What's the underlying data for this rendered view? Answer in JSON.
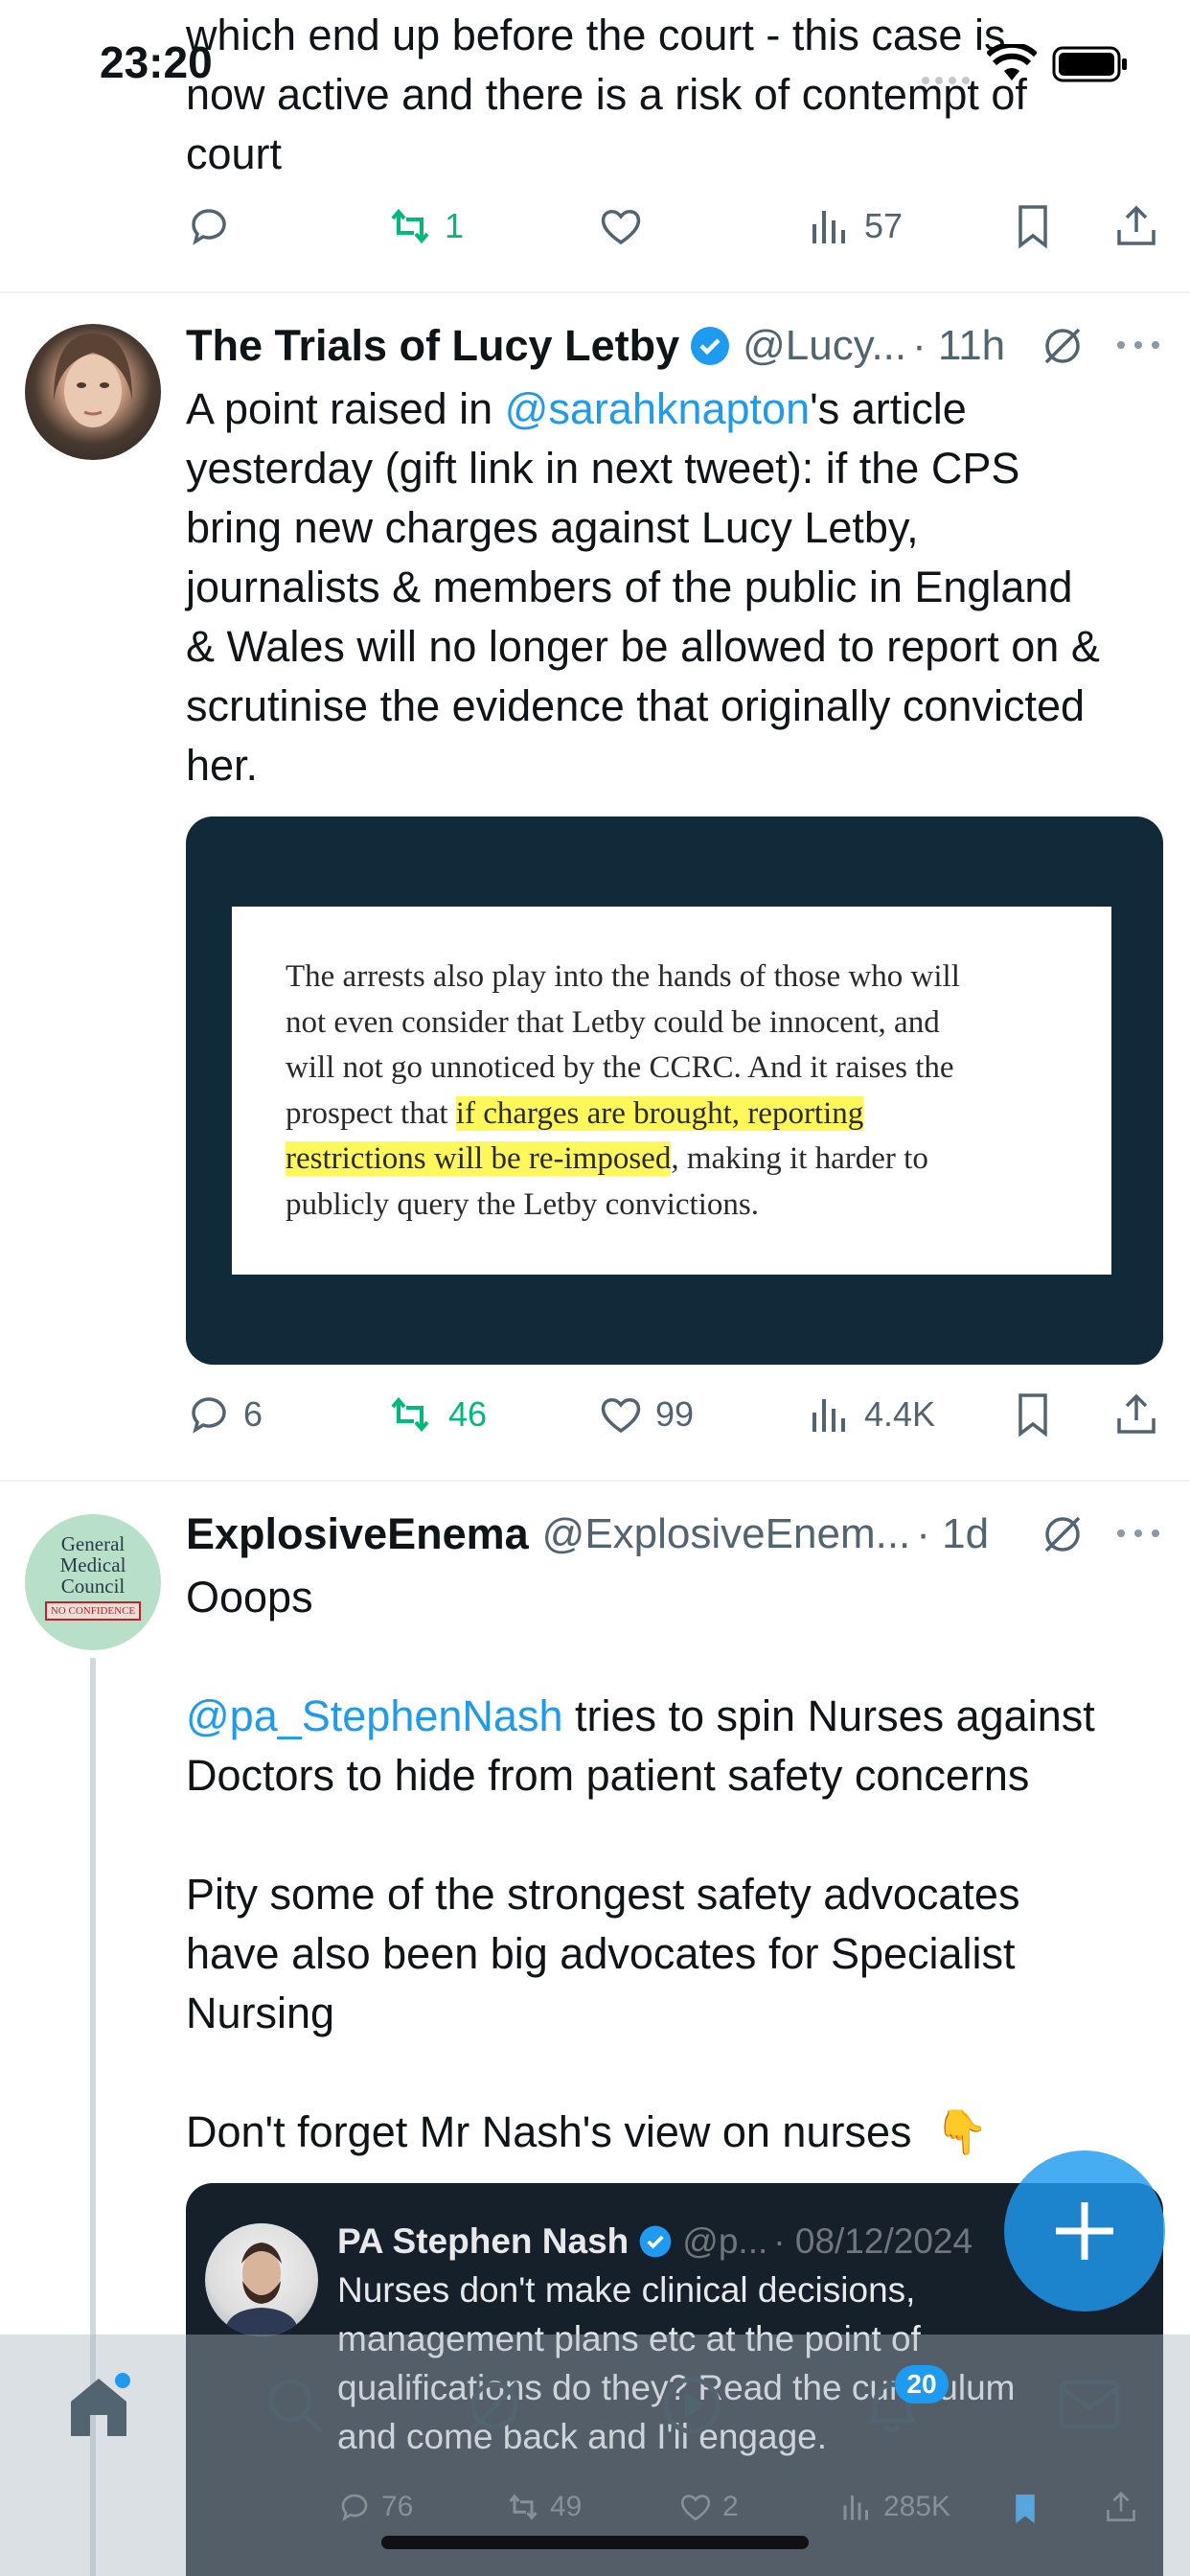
{
  "status_bar": {
    "time": "23:20"
  },
  "tweet_top": {
    "text_lines": [
      "which end up before the court - this case is",
      "now active and there is a risk of contempt of",
      "court"
    ],
    "actions": {
      "replies": "",
      "retweets": "1",
      "likes": "",
      "views": "57"
    }
  },
  "tweet_lucy": {
    "name": "The Trials of Lucy Letby",
    "handle": "@Lucy...",
    "time": "· 11h",
    "text_before_mention": "A point raised in ",
    "mention": "@sarahknapton",
    "text_after_mention": "'s article",
    "text_lines": [
      "yesterday (gift link in next tweet): if the CPS",
      "bring new charges against Lucy Letby,",
      "journalists & members of the public in England",
      "& Wales will no longer be allowed to report on &",
      "scrutinise the evidence that originally convicted",
      "her."
    ],
    "image_text": {
      "line1": "The arrests also play into the hands of those who will",
      "line2": "not even consider that Letby could be innocent, and",
      "line3": "will not go unnoticed by the CCRC. And it raises the",
      "line4_plain": "prospect that ",
      "line4_hl": "if charges are brought, reporting",
      "line5_hl": "restrictions will be re-imposed",
      "line5_plain": ", making it harder to",
      "line6": "publicly query the Letby convictions."
    },
    "actions": {
      "replies": "6",
      "retweets": "46",
      "likes": "99",
      "views": "4.4K"
    }
  },
  "tweet_enema": {
    "name": "ExplosiveEnema",
    "handle": "@ExplosiveEnem...",
    "time": "· 1d",
    "avatar_text": {
      "l1": "General",
      "l2": "Medical",
      "l3": "Council",
      "l4": "NO CONFIDENCE"
    },
    "line_ooops": "Ooops",
    "mention": "@pa_StephenNash",
    "mention_tail": " tries to spin Nurses against",
    "line2": "Doctors to hide from patient safety concerns",
    "para2_l1": "Pity some of the strongest safety advocates",
    "para2_l2": "have also been big advocates for Specialist",
    "para2_l3": "Nursing",
    "para3": "Don't forget Mr Nash's view on nurses",
    "emoji": "👇",
    "quoted": {
      "name": "PA Stephen Nash",
      "handle": "@p...",
      "date": "· 08/12/2024",
      "lines": [
        "Nurses don't make clinical decisions,",
        "management plans etc at the point of",
        "qualifications do they? Read the curriculum",
        "and come back and I'll engage."
      ],
      "actions": {
        "replies": "76",
        "retweets": "49",
        "likes": "2",
        "views": "285K"
      }
    }
  },
  "tab_bar": {
    "notifications_badge": "20"
  },
  "colors": {
    "accent": "#1d9bf0",
    "retweet": "#00ba7c",
    "text": "#0f1419",
    "muted": "#536471"
  }
}
